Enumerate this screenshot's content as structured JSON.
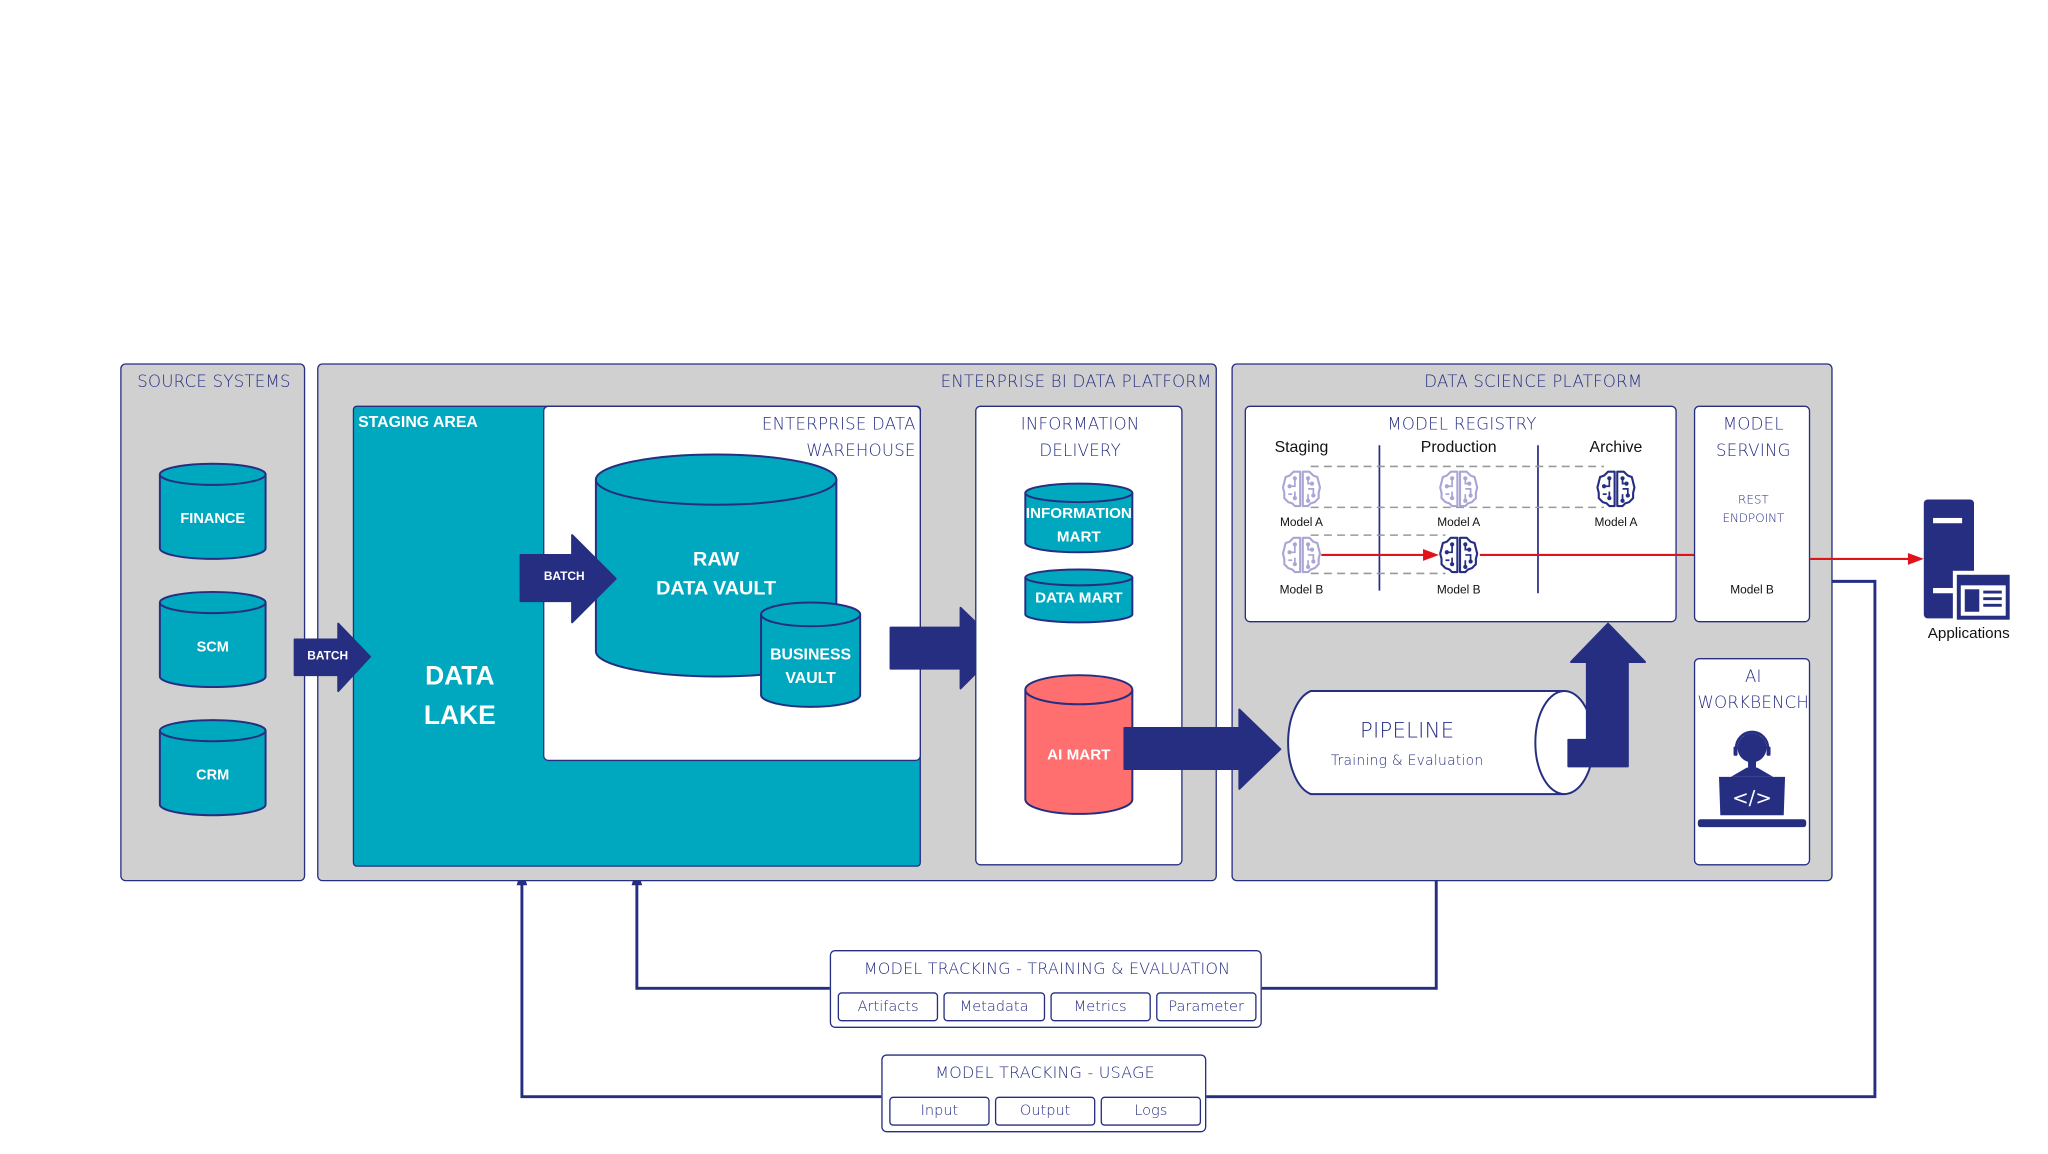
{
  "colors": {
    "navy": "#262e82",
    "teal": "#00a8bf",
    "panel_gray": "#d0d0d0",
    "ai_mart": "#ff6f6f",
    "flow_red": "#e0131a"
  },
  "source_systems": {
    "title": "SOURCE SYSTEMS",
    "databases": [
      "FINANCE",
      "SCM",
      "CRM"
    ]
  },
  "batch_labels": {
    "to_lake": "BATCH",
    "to_vault": "BATCH"
  },
  "enterprise_bi": {
    "title": "ENTERPRISE BI DATA PLATFORM",
    "staging_area": {
      "title": "STAGING AREA",
      "data_lake_line1": "DATA",
      "data_lake_line2": "LAKE"
    },
    "edw": {
      "title_line1": "ENTERPRISE DATA",
      "title_line2": "WAREHOUSE",
      "raw_vault_line1": "RAW",
      "raw_vault_line2": "DATA VAULT",
      "business_vault_line1": "BUSINESS",
      "business_vault_line2": "VAULT"
    },
    "information_delivery": {
      "title_line1": "INFORMATION",
      "title_line2": "DELIVERY",
      "info_mart_line1": "INFORMATION",
      "info_mart_line2": "MART",
      "data_mart": "DATA MART",
      "ai_mart": "AI MART"
    }
  },
  "data_science": {
    "title": "DATA SCIENCE PLATFORM",
    "registry": {
      "title": "MODEL REGISTRY",
      "columns": [
        "Staging",
        "Production",
        "Archive"
      ],
      "models": {
        "staging_a": "Model A",
        "staging_b": "Model B",
        "production_a": "Model A",
        "production_b": "Model B",
        "archive_a": "Model A"
      }
    },
    "serving": {
      "title_line1": "MODEL",
      "title_line2": "SERVING",
      "endpoint_line1": "REST",
      "endpoint_line2": "ENDPOINT",
      "model": "Model B"
    },
    "workbench": {
      "title_line1": "AI",
      "title_line2": "WORKBENCH"
    },
    "pipeline": {
      "title": "PIPELINE",
      "subtitle": "Training & Evaluation"
    }
  },
  "applications": {
    "label": "Applications"
  },
  "tracking_training": {
    "title": "MODEL TRACKING - TRAINING & EVALUATION",
    "items": [
      "Artifacts",
      "Metadata",
      "Metrics",
      "Parameter"
    ]
  },
  "tracking_usage": {
    "title": "MODEL TRACKING - USAGE",
    "items": [
      "Input",
      "Output",
      "Logs"
    ]
  }
}
